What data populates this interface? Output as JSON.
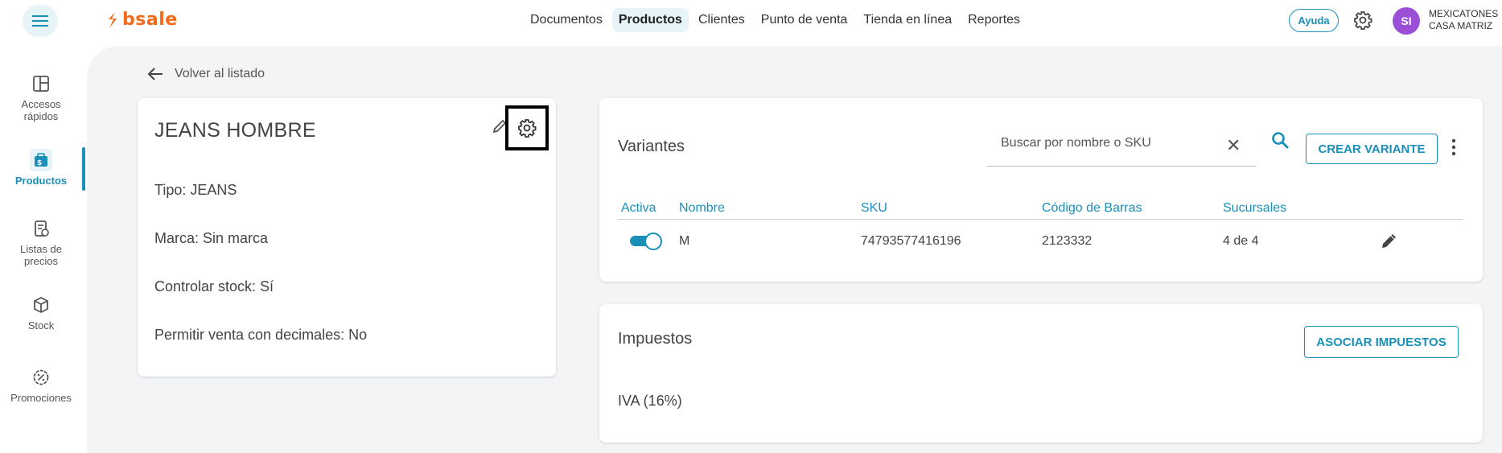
{
  "brand": {
    "name": "bsale",
    "accent": "#1a8fb8",
    "logo_color": "#f26a1b"
  },
  "topnav": {
    "items": [
      "Documentos",
      "Productos",
      "Clientes",
      "Punto de venta",
      "Tienda en línea",
      "Reportes"
    ],
    "active": "Productos"
  },
  "header": {
    "help_label": "Ayuda",
    "avatar_initials": "SI",
    "company_line1": "MEXICATONES",
    "company_line2": "CASA MATRIZ"
  },
  "sidebar": {
    "items": [
      {
        "label1": "Accesos",
        "label2": "rápidos",
        "icon": "dashboard-icon"
      },
      {
        "label1": "Productos",
        "label2": "",
        "icon": "products-icon"
      },
      {
        "label1": "Listas de",
        "label2": "precios",
        "icon": "price-list-icon"
      },
      {
        "label1": "Stock",
        "label2": "",
        "icon": "box-icon"
      },
      {
        "label1": "Promociones",
        "label2": "",
        "icon": "discount-icon"
      }
    ]
  },
  "back_label": "Volver al listado",
  "product": {
    "title": "JEANS HOMBRE",
    "tipo": "Tipo: JEANS",
    "marca": "Marca: Sin marca",
    "stock": "Controlar stock: Sí",
    "decimales": "Permitir venta con decimales: No"
  },
  "variants": {
    "title": "Variantes",
    "search_placeholder": "Buscar por nombre o SKU",
    "create_label": "CREAR VARIANTE",
    "columns": [
      "Activa",
      "Nombre",
      "SKU",
      "Código de Barras",
      "Sucursales"
    ],
    "rows": [
      {
        "active": true,
        "nombre": "M",
        "sku": "74793577416196",
        "barcode": "2123332",
        "sucursales": "4 de 4"
      }
    ]
  },
  "taxes": {
    "title": "Impuestos",
    "assoc_label": "ASOCIAR IMPUESTOS",
    "items": [
      "IVA (16%)"
    ]
  }
}
